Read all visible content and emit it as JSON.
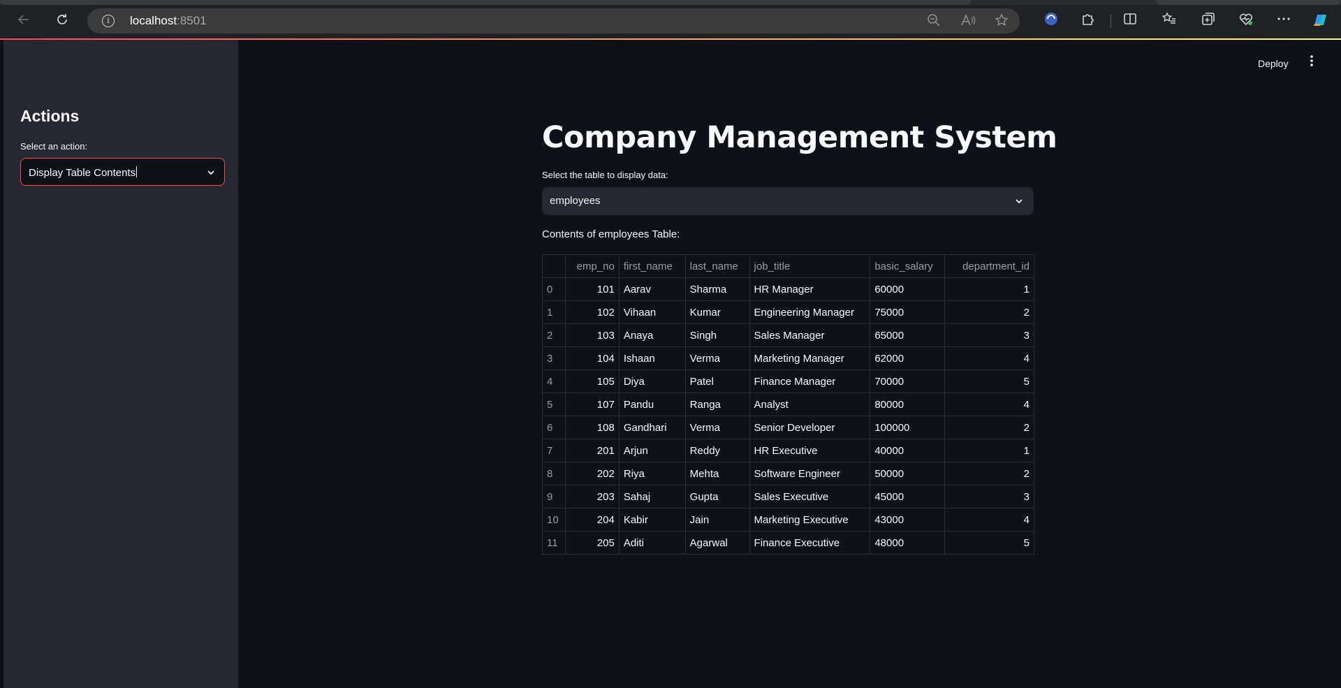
{
  "browser": {
    "url_host": "localhost",
    "url_port": ":8501"
  },
  "sidebar": {
    "heading": "Actions",
    "action_label": "Select an action:",
    "action_value": "Display Table Contents"
  },
  "header": {
    "deploy_label": "Deploy"
  },
  "main": {
    "title": "Company Management System",
    "table_select_label": "Select the table to display data:",
    "table_select_value": "employees",
    "contents_label": "Contents of employees Table:"
  },
  "table": {
    "columns": [
      "",
      "emp_no",
      "first_name",
      "last_name",
      "job_title",
      "basic_salary",
      "department_id"
    ],
    "rows": [
      [
        "0",
        "101",
        "Aarav",
        "Sharma",
        "HR Manager",
        "60000",
        "1"
      ],
      [
        "1",
        "102",
        "Vihaan",
        "Kumar",
        "Engineering Manager",
        "75000",
        "2"
      ],
      [
        "2",
        "103",
        "Anaya",
        "Singh",
        "Sales Manager",
        "65000",
        "3"
      ],
      [
        "3",
        "104",
        "Ishaan",
        "Verma",
        "Marketing Manager",
        "62000",
        "4"
      ],
      [
        "4",
        "105",
        "Diya",
        "Patel",
        "Finance Manager",
        "70000",
        "5"
      ],
      [
        "5",
        "107",
        "Pandu",
        "Ranga",
        "Analyst",
        "80000",
        "4"
      ],
      [
        "6",
        "108",
        "Gandhari",
        "Verma",
        "Senior Developer",
        "100000",
        "2"
      ],
      [
        "7",
        "201",
        "Arjun",
        "Reddy",
        "HR Executive",
        "40000",
        "1"
      ],
      [
        "8",
        "202",
        "Riya",
        "Mehta",
        "Software Engineer",
        "50000",
        "2"
      ],
      [
        "9",
        "203",
        "Sahaj",
        "Gupta",
        "Sales Executive",
        "45000",
        "3"
      ],
      [
        "10",
        "204",
        "Kabir",
        "Jain",
        "Marketing Executive",
        "43000",
        "4"
      ],
      [
        "11",
        "205",
        "Aditi",
        "Agarwal",
        "Finance Executive",
        "48000",
        "5"
      ]
    ]
  },
  "colors": {
    "accent": "#ff4b4b",
    "background": "#0e1117",
    "sidebar": "#262730"
  }
}
